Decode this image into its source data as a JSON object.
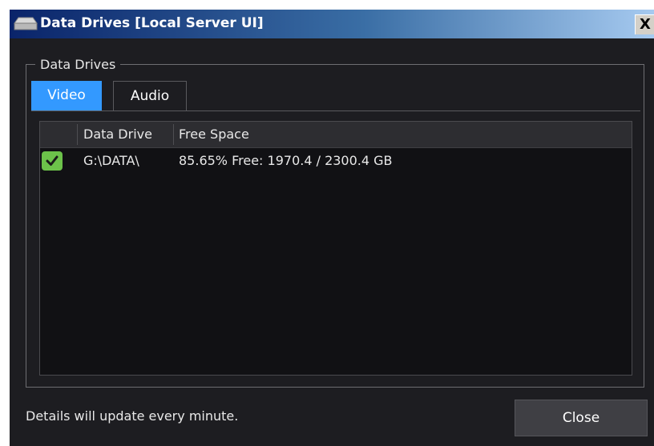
{
  "window": {
    "title": "Data Drives [Local Server UI]",
    "close_glyph": "X"
  },
  "group": {
    "label": "Data Drives"
  },
  "tabs": [
    {
      "label": "Video",
      "selected": true
    },
    {
      "label": "Audio",
      "selected": false
    }
  ],
  "table": {
    "columns": [
      "",
      "Data Drive",
      "Free Space"
    ],
    "rows": [
      {
        "status_icon": "check-icon",
        "drive": "G:\\DATA\\",
        "free_space": "85.65% Free: 1970.4 / 2300.4 GB"
      }
    ]
  },
  "footer": {
    "status_text": "Details will update every minute.",
    "close_label": "Close"
  },
  "colors": {
    "title_gradient_start": "#0a246a",
    "title_gradient_end": "#a6caf0",
    "background": "#1d1d21",
    "selected_tab": "#3399ff",
    "check_green": "#6cc24a",
    "button": "#3f3f44"
  }
}
